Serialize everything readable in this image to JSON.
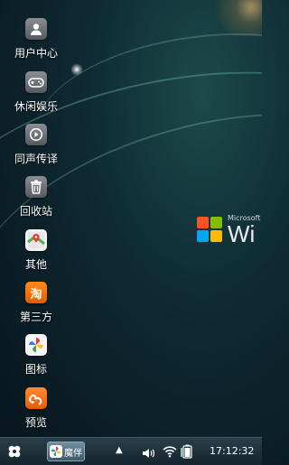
{
  "desktop": {
    "icons": [
      {
        "label": "用户中心",
        "icon": "user-icon"
      },
      {
        "label": "休闲娱乐",
        "icon": "gamepad-icon"
      },
      {
        "label": "同声传译",
        "icon": "play-icon"
      },
      {
        "label": "回收站",
        "icon": "trash-icon"
      },
      {
        "label": "其他",
        "icon": "map-icon"
      },
      {
        "label": "第三方",
        "icon": "taobao-icon"
      },
      {
        "label": "图标",
        "icon": "pinwheel-icon"
      },
      {
        "label": "预览",
        "icon": "uc-browser-icon"
      }
    ],
    "watermark": {
      "small": "Microsoft",
      "big": "Wi"
    }
  },
  "taskbar": {
    "app_label": "魔伴",
    "tray_arrow": "▲",
    "clock": "17:12:32"
  }
}
